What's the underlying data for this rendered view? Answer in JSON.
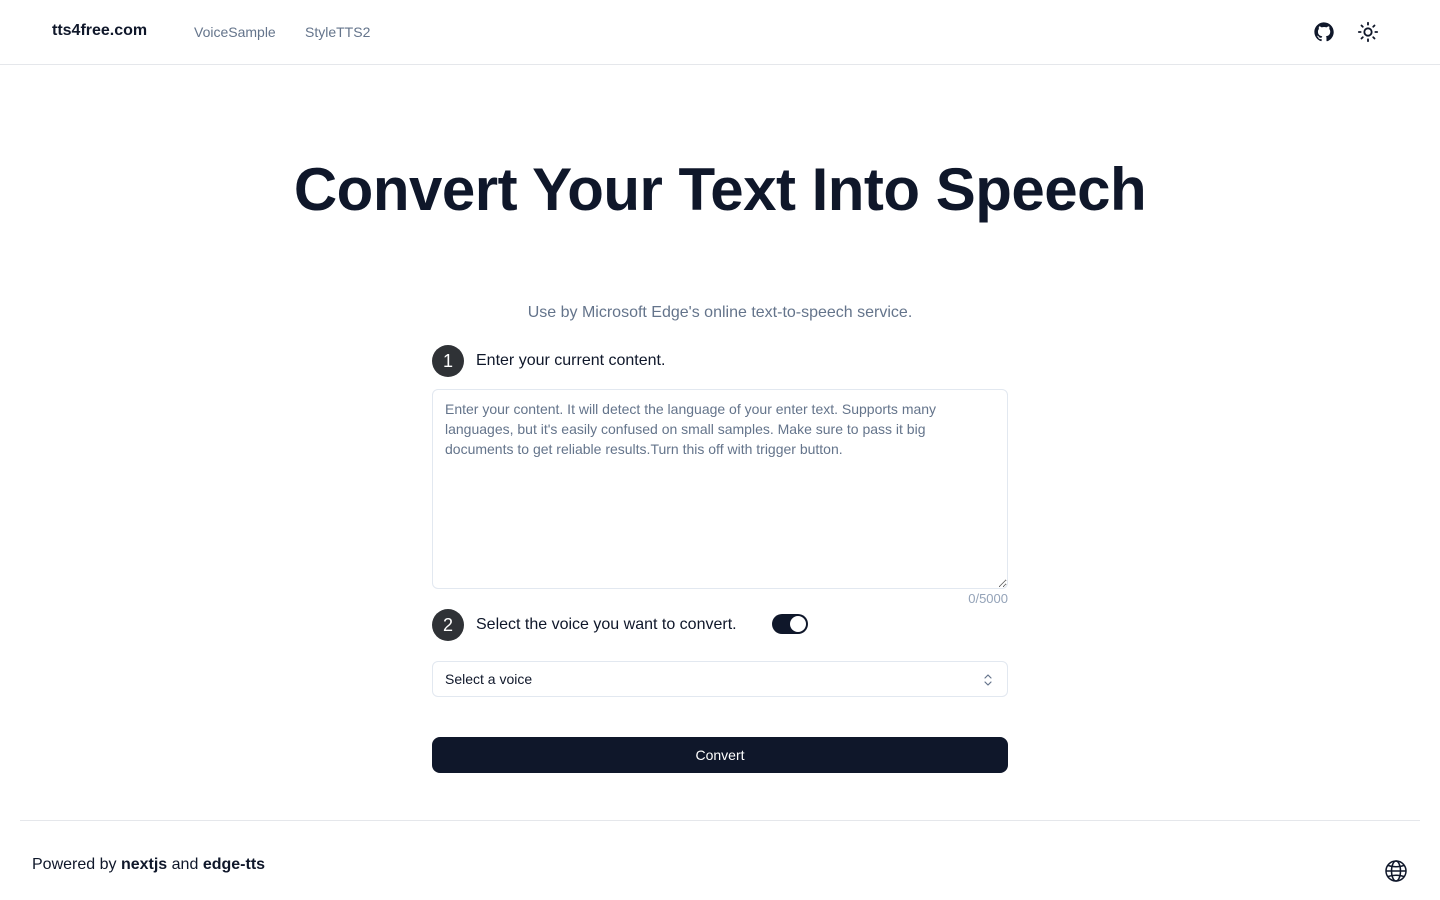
{
  "header": {
    "logo": "tts4free.com",
    "nav": [
      {
        "label": "VoiceSample"
      },
      {
        "label": "StyleTTS2"
      }
    ],
    "icons": {
      "github": "github-icon",
      "theme": "sun-icon"
    }
  },
  "hero": {
    "title": "Convert Your Text Into Speech",
    "subtitle": "Use by Microsoft Edge's online text-to-speech service."
  },
  "step1": {
    "number": "1",
    "label": "Enter your current content.",
    "textarea": {
      "value": "",
      "placeholder": "Enter your content. It will detect the language of your enter text. Supports many languages, but it's easily confused on small samples. Make sure to pass it big documents to get reliable results.Turn this off with trigger button."
    },
    "char_count": "0/5000"
  },
  "step2": {
    "number": "2",
    "label": "Select the voice you want to convert.",
    "toggle_on": true,
    "select": {
      "value": "Select a voice"
    }
  },
  "convert_button": "Convert",
  "footer": {
    "prefix": "Powered by",
    "link1": "nextjs",
    "conjunction": "and",
    "link2": "edge-tts",
    "icon": "globe-icon"
  },
  "colors": {
    "primary": "#0f172a",
    "muted": "#64748b",
    "border": "#e2e8f0",
    "badge": "#2f3236"
  }
}
